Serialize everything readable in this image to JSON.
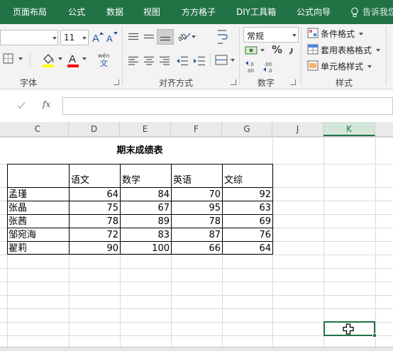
{
  "ribbon_tabs": [
    "页面布局",
    "公式",
    "数据",
    "视图",
    "方方格子",
    "DIY工具箱",
    "公式向导"
  ],
  "tell_me": "告诉我您",
  "font": {
    "size": "11",
    "group_label": "字体"
  },
  "alignment": {
    "group_label": "对齐方式"
  },
  "number": {
    "format": "常规",
    "percent_symbol": "%",
    "group_label": "数字"
  },
  "styles": {
    "conditional_format": "条件格式",
    "table_format": "套用表格格式",
    "cell_styles": "单元格样式",
    "group_label": "样式"
  },
  "formula_bar": {
    "fx": "fx",
    "content": ""
  },
  "columns": [
    "C",
    "D",
    "E",
    "F",
    "G",
    "J",
    "K"
  ],
  "selected_column": "K",
  "colors": {
    "accent": "#217346",
    "fill_highlight": "#ffff00",
    "font_red": "#ff0000"
  },
  "table": {
    "title": "期末成绩表",
    "headers": [
      "",
      "语文",
      "数学",
      "英语",
      "文综"
    ],
    "rows": [
      [
        "孟瑾",
        "64",
        "84",
        "70",
        "92"
      ],
      [
        "张晶",
        "75",
        "67",
        "95",
        "63"
      ],
      [
        "张茜",
        "78",
        "89",
        "78",
        "69"
      ],
      [
        "邹宛海",
        "72",
        "83",
        "87",
        "76"
      ],
      [
        "翟莉",
        "90",
        "100",
        "66",
        "64"
      ]
    ]
  }
}
